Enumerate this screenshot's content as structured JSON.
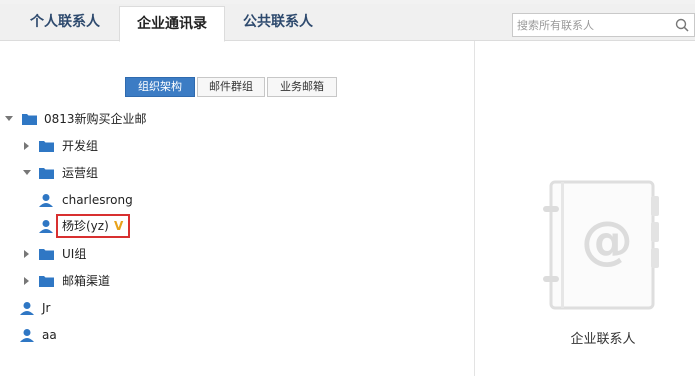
{
  "tabs": [
    {
      "label": "个人联系人",
      "active": false
    },
    {
      "label": "企业通讯录",
      "active": true
    },
    {
      "label": "公共联系人",
      "active": false
    }
  ],
  "search": {
    "placeholder": "搜索所有联系人",
    "value": "",
    "icon": "search-icon"
  },
  "view_toggle": [
    "组织架构",
    "邮件群组",
    "业务邮箱"
  ],
  "tree": {
    "root": "0813新购买企业邮",
    "groups": {
      "dev": "开发组",
      "ops": "运营组",
      "ui": "UI组",
      "channel": "邮箱渠道"
    },
    "ops_members": {
      "m1": "charlesrong",
      "m2": "杨珍(yz)",
      "m2_badge": "V"
    },
    "root_members": {
      "m1": "Jr",
      "m2": "aa"
    }
  },
  "right_panel": {
    "caption": "企业联系人",
    "icon": "address-book-icon"
  },
  "colors": {
    "accent": "#3c7cc4",
    "folder": "#2f77c4",
    "highlight": "#d83030",
    "vip": "#e8a21a"
  }
}
